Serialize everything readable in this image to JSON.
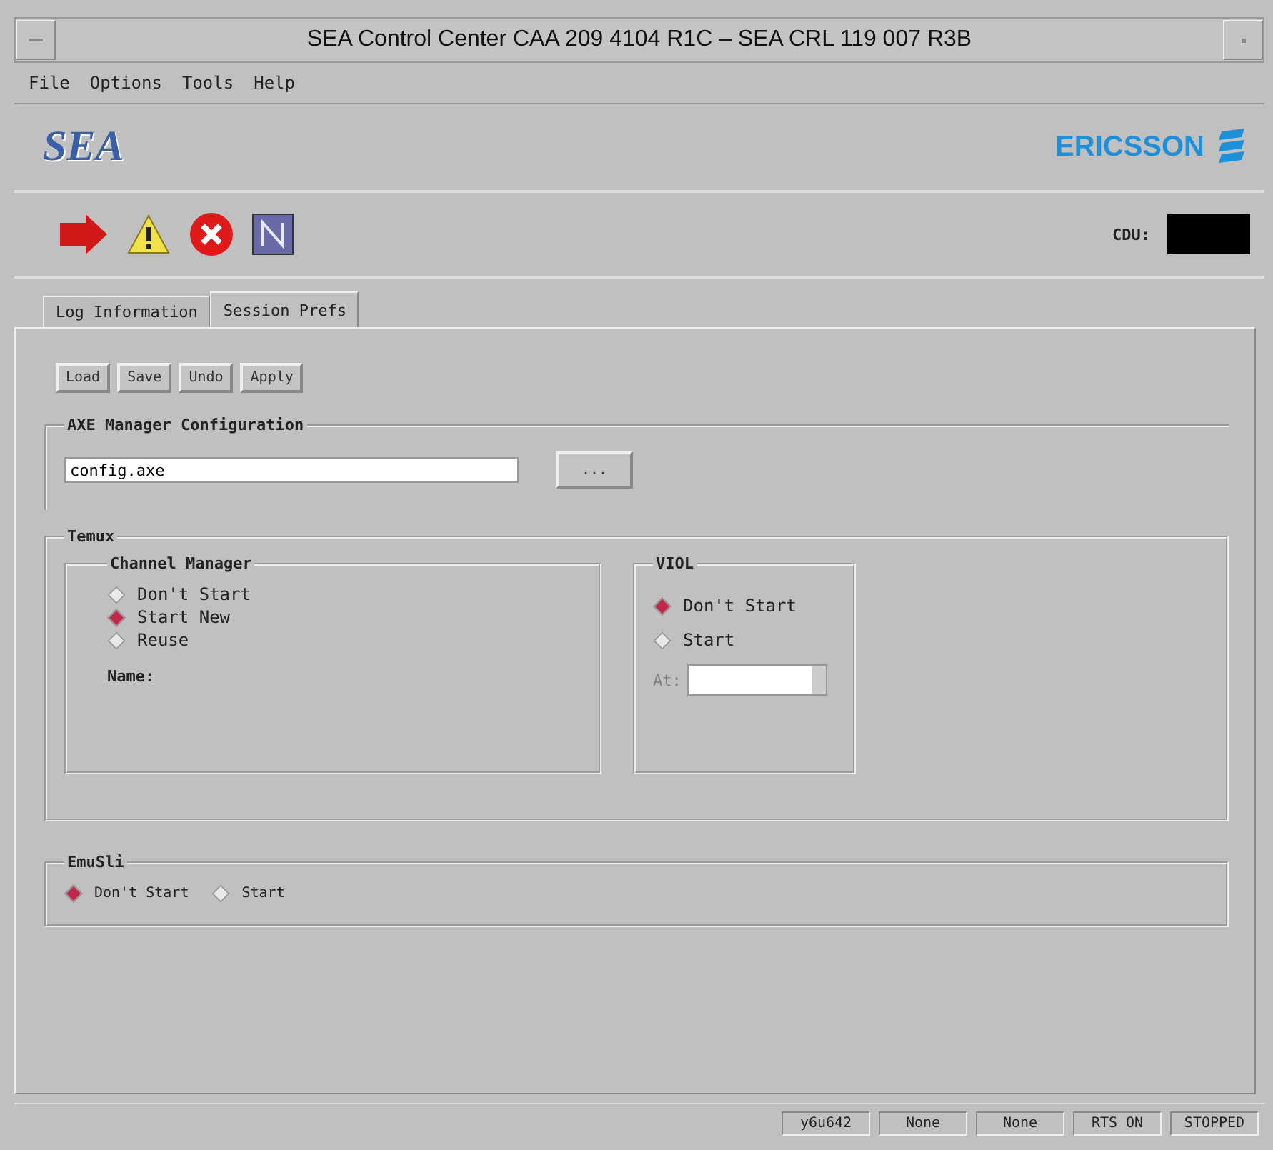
{
  "window": {
    "title": "SEA Control Center   CAA 209 4104 R1C  –  SEA CRL 119 007 R3B"
  },
  "menu": [
    "File",
    "Options",
    "Tools",
    "Help"
  ],
  "logos": {
    "left": "SEA",
    "right": "ERICSSON"
  },
  "cdu": {
    "label": "CDU:"
  },
  "tabs": [
    {
      "label": "Log Information",
      "selected": false
    },
    {
      "label": "Session Prefs",
      "selected": true
    }
  ],
  "buttons": [
    "Load",
    "Save",
    "Undo",
    "Apply"
  ],
  "axe_config": {
    "title": "AXE Manager Configuration",
    "value": "config.axe",
    "browse": "..."
  },
  "temux": {
    "title": "Temux",
    "channel_manager": {
      "title": "Channel Manager",
      "options": [
        {
          "label": "Don't Start",
          "selected": false
        },
        {
          "label": "Start New",
          "selected": true
        },
        {
          "label": "Reuse",
          "selected": false
        }
      ],
      "name_label": "Name:"
    },
    "viol": {
      "title": "VIOL",
      "options": [
        {
          "label": "Don't Start",
          "selected": true
        },
        {
          "label": "Start",
          "selected": false
        }
      ],
      "at_label": "At:",
      "at_disabled": true
    }
  },
  "emusli": {
    "title": "EmuSli",
    "options": [
      {
        "label": "Don't Start",
        "selected": true
      },
      {
        "label": "Start",
        "selected": false
      }
    ]
  },
  "status_bar": [
    "y6u642",
    "None",
    "None",
    "RTS ON",
    "STOPPED"
  ]
}
